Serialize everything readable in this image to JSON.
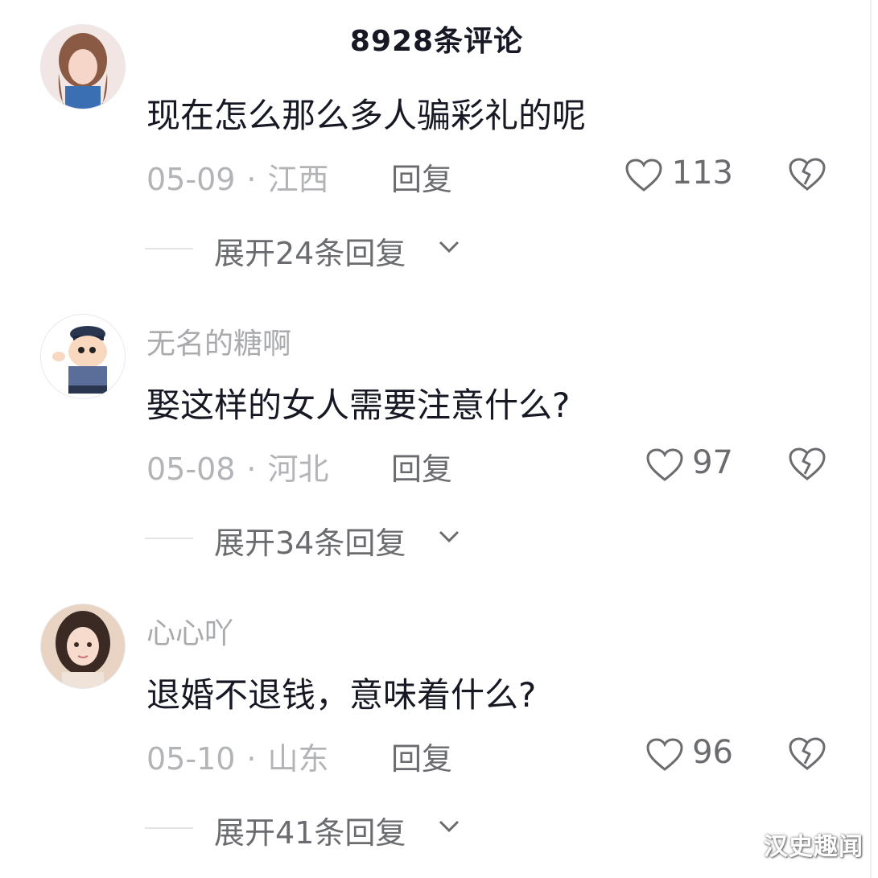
{
  "header": {
    "title": "8928条评论"
  },
  "comments": [
    {
      "username": "",
      "content": "现在怎么那么多人骗彩礼的呢",
      "date": "05-09",
      "location": "江西",
      "reply_label": "回复",
      "likes": "113",
      "expand_label": "展开24条回复"
    },
    {
      "username": "无名的糖啊",
      "content": "娶这样的女人需要注意什么?",
      "date": "05-08",
      "location": "河北",
      "reply_label": "回复",
      "likes": "97",
      "expand_label": "展开34条回复"
    },
    {
      "username": "心心吖",
      "content": "退婚不退钱，意味着什么?",
      "date": "05-10",
      "location": "山东",
      "reply_label": "回复",
      "likes": "96",
      "expand_label": "展开41条回复"
    }
  ],
  "meta_separator": "·",
  "icons": {
    "like": "heart-outline-icon",
    "dislike": "broken-heart-icon",
    "expand": "chevron-down-icon"
  },
  "colors": {
    "primary_text": "#161823",
    "secondary_text": "#6b6c70",
    "muted_text": "#b3b4b7"
  },
  "watermark": "汉史趣闻"
}
